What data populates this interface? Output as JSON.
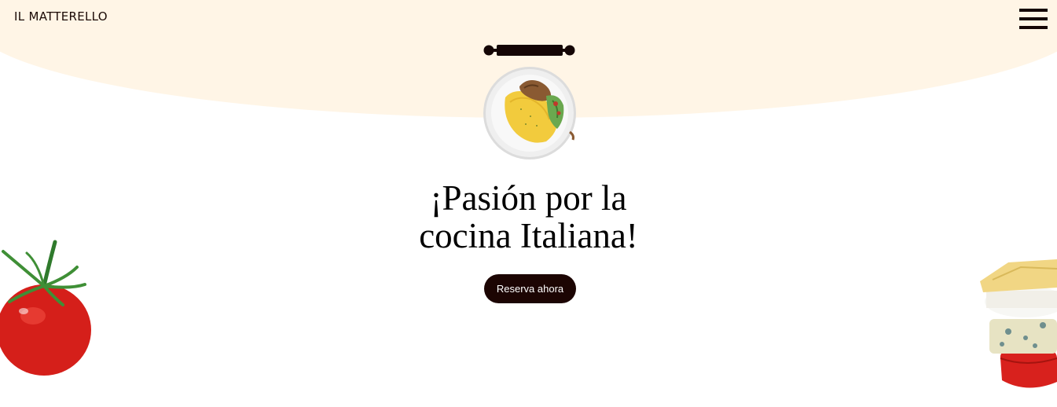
{
  "header": {
    "brand": "IL MATTERELLO",
    "menu_icon": "hamburger-menu-icon"
  },
  "hero": {
    "decoration_icon": "rolling-pin-icon",
    "dish_image": "omelette-dish-plate",
    "headline_line1": "¡Pasión por la",
    "headline_line2": "cocina Italiana!",
    "cta_label": "Reserva ahora"
  },
  "decorations": {
    "left_image": "tomato",
    "right_image": "stacked-cheeses"
  },
  "colors": {
    "band_background": "#fff5e6",
    "dark_accent": "#1c0503",
    "text": "#000000"
  }
}
